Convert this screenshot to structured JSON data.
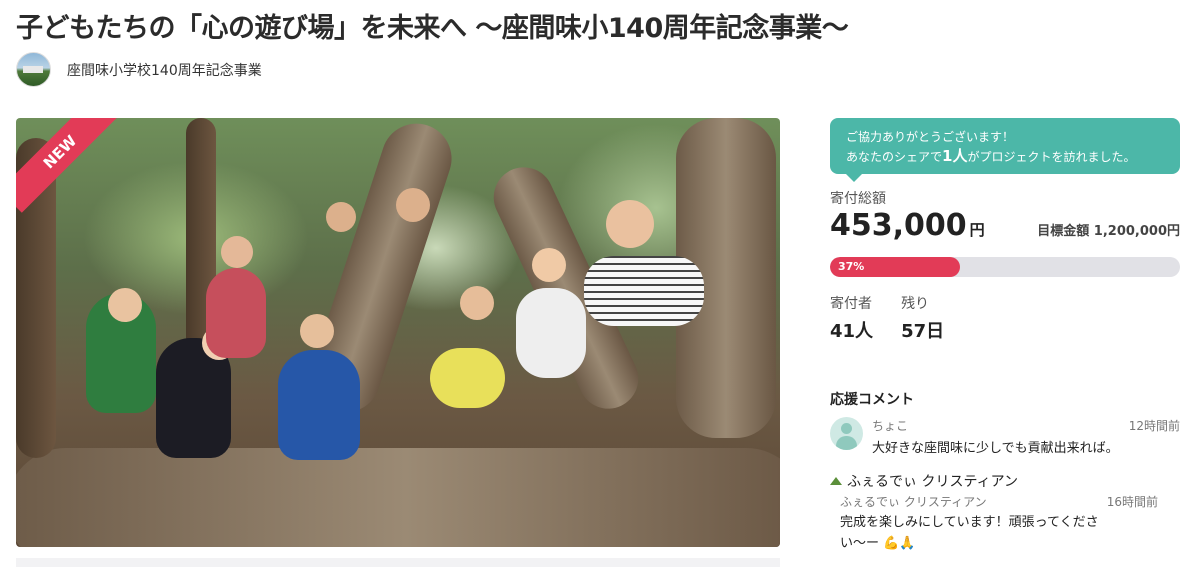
{
  "project": {
    "title": "子どもたちの「心の遊び場」を未来へ ～座間味小140周年記念事業～",
    "owner": "座間味小学校140周年記念事業",
    "badge": "NEW"
  },
  "share_notice": {
    "line1": "ご協力ありがとうございます！",
    "line2_prefix": "あなたのシェアで",
    "line2_count": "1人",
    "line2_suffix": "がプロジェクトを訪れました。"
  },
  "funding": {
    "total_label": "寄付総額",
    "amount": "453,000",
    "currency": "円",
    "goal_label": "目標金額",
    "goal_value": "1,200,000円",
    "progress_label": "37%",
    "progress": 0.37,
    "donors_label": "寄付者",
    "donors_value": "41人",
    "remaining_label": "残り",
    "remaining_value": "57日"
  },
  "comments": {
    "title": "応援コメント",
    "items": [
      {
        "author": "ちょこ",
        "time": "12時間前",
        "text": "大好きな座間味に少しでも貢献出来れば。"
      },
      {
        "display_name": "ふぇるでぃ クリスティアン",
        "author": "ふぇるでぃ クリスティアン",
        "time": "16時間前",
        "text": "完成を楽しみにしています！頑張ってくださ",
        "text2": "い～ー"
      }
    ]
  },
  "colors": {
    "accent": "#e23b57",
    "teal": "#4cb7a8",
    "track": "#e1e1e6"
  },
  "icons": [
    "avatar",
    "user-icon",
    "broken-image-icon",
    "flexed-biceps-icon",
    "folded-hands-icon"
  ]
}
